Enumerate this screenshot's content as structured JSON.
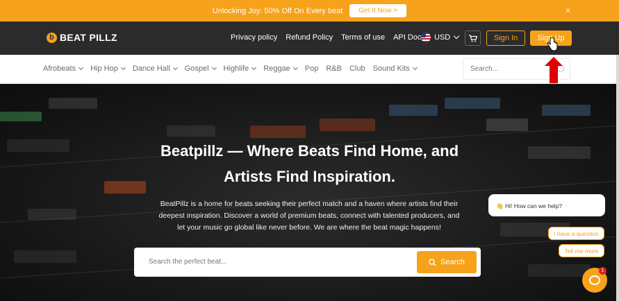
{
  "promo": {
    "text": "Unlocking Joy: 50% Off On Every beat",
    "cta": "Get It Now >",
    "close": "×"
  },
  "header": {
    "logo_mark": "b",
    "logo_text": "BEAT PILLZ",
    "nav": [
      "Privacy policy",
      "Refund Policy",
      "Terms of use",
      "API Docs"
    ],
    "currency": "USD",
    "sign_in": "Sign In",
    "sign_up": "Sign Up"
  },
  "categories": {
    "items": [
      {
        "label": "Afrobeats",
        "has_dropdown": true
      },
      {
        "label": "Hip Hop",
        "has_dropdown": true
      },
      {
        "label": "Dance Hall",
        "has_dropdown": true
      },
      {
        "label": "Gospel",
        "has_dropdown": true
      },
      {
        "label": "Highlife",
        "has_dropdown": true
      },
      {
        "label": "Reggae",
        "has_dropdown": true
      },
      {
        "label": "Pop",
        "has_dropdown": false
      },
      {
        "label": "R&B",
        "has_dropdown": false
      },
      {
        "label": "Club",
        "has_dropdown": false
      },
      {
        "label": "Sound Kits",
        "has_dropdown": true
      }
    ],
    "search_placeholder": "Search..."
  },
  "hero": {
    "title_line1": "Beatpillz — Where Beats Find Home, and",
    "title_line2": "Artists Find Inspiration.",
    "desc_line1": "BeatPillz is a home for beats seeking their perfect match and a haven where artists find their",
    "desc_line2": "deepest inspiration. Discover a world of premium beats, connect with talented producers, and",
    "desc_line3": "let your music go global like never before. We are where the beat magic happens!",
    "search_placeholder": "Search the perfect beat...",
    "search_button": "Search"
  },
  "chat": {
    "greeting": "👋 Hi! How can we help?",
    "option1": "I have a question",
    "option2": "Tell me more",
    "badge": "1"
  },
  "colors": {
    "accent": "#f7a21b",
    "header_bg": "#2b2b2b",
    "annotation_arrow": "#e00000"
  }
}
